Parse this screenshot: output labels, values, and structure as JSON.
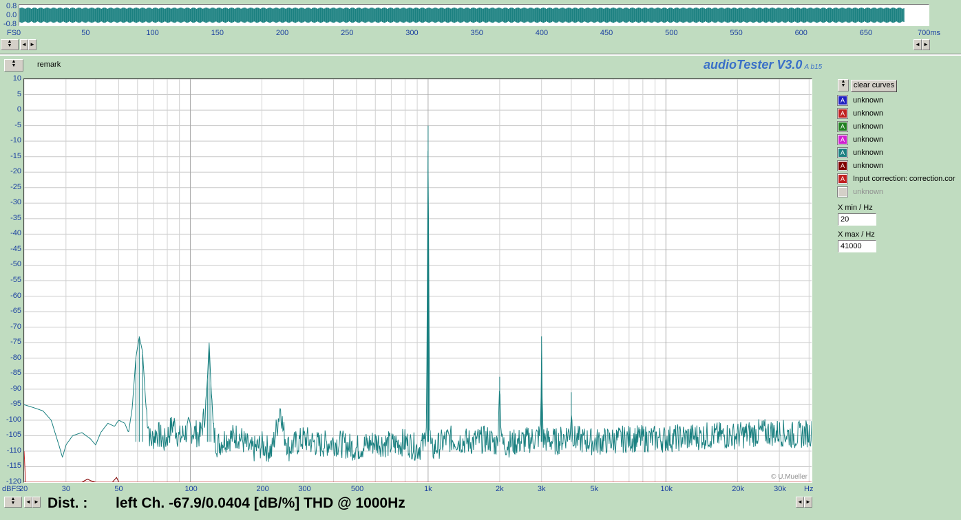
{
  "waveform": {
    "y_ticks": [
      "0.8",
      "0.0",
      "-0.8"
    ],
    "fs_label": "FS",
    "x_ticks": [
      "0",
      "50",
      "100",
      "150",
      "200",
      "250",
      "300",
      "350",
      "400",
      "450",
      "500",
      "550",
      "600",
      "650"
    ],
    "x_end_label": "700ms",
    "signal_end_ms": 682,
    "color": "#1a8080"
  },
  "header": {
    "remark_label": "remark",
    "app_title": "audioTester V3.0",
    "version": "A b15"
  },
  "legend": {
    "clear_button": "clear curves",
    "items": [
      {
        "label": "unknown",
        "color": "#2020c0"
      },
      {
        "label": "unknown",
        "color": "#c02020"
      },
      {
        "label": "unknown",
        "color": "#208020"
      },
      {
        "label": "unknown",
        "color": "#d020d0"
      },
      {
        "label": "unknown",
        "color": "#1a8080"
      },
      {
        "label": "unknown",
        "color": "#800000"
      },
      {
        "label": "Input correction: correction.cor",
        "color": "#c02020"
      },
      {
        "label": "unknown",
        "color": "#d4d0c8",
        "disabled": true
      }
    ],
    "xmin_label": "X min / Hz",
    "xmin_value": "20",
    "xmax_label": "X max / Hz",
    "xmax_value": "41000"
  },
  "status": {
    "dist_label": "Dist. :",
    "result_text": "left Ch. -67.9/0.0404 [dB/%] THD @ 1000Hz"
  },
  "chart_data": {
    "type": "line",
    "xscale": "log",
    "xlim": [
      20,
      41000
    ],
    "ylim": [
      -120,
      10
    ],
    "ylabel": "dBFS",
    "xunit": "Hz",
    "y_ticks": [
      10,
      5,
      0,
      -5,
      -10,
      -15,
      -20,
      -25,
      -30,
      -35,
      -40,
      -45,
      -50,
      -55,
      -60,
      -65,
      -70,
      -75,
      -80,
      -85,
      -90,
      -95,
      -100,
      -105,
      -110,
      -115,
      -120
    ],
    "x_tick_labels": [
      {
        "v": 30,
        "t": "30"
      },
      {
        "v": 50,
        "t": "50"
      },
      {
        "v": 100,
        "t": "100"
      },
      {
        "v": 200,
        "t": "200"
      },
      {
        "v": 300,
        "t": "300"
      },
      {
        "v": 500,
        "t": "500"
      },
      {
        "v": 1000,
        "t": "1k"
      },
      {
        "v": 2000,
        "t": "2k"
      },
      {
        "v": 3000,
        "t": "3k"
      },
      {
        "v": 5000,
        "t": "5k"
      },
      {
        "v": 10000,
        "t": "10k"
      },
      {
        "v": 20000,
        "t": "20k"
      },
      {
        "v": 30000,
        "t": "30k"
      }
    ],
    "x_first_label": "20",
    "watermark": "© U.Mueller",
    "grid": true,
    "series": [
      {
        "color": "#1a8080",
        "noise_floor": -106,
        "points": [
          [
            20,
            -95
          ],
          [
            22,
            -96
          ],
          [
            24,
            -97
          ],
          [
            26,
            -100
          ],
          [
            28,
            -108
          ],
          [
            29,
            -112
          ],
          [
            30,
            -108
          ],
          [
            32,
            -105
          ],
          [
            35,
            -104
          ],
          [
            38,
            -106
          ],
          [
            40,
            -108
          ],
          [
            42,
            -104
          ],
          [
            45,
            -101
          ],
          [
            48,
            -102
          ],
          [
            50,
            -100
          ],
          [
            53,
            -101
          ],
          [
            55,
            -104
          ],
          [
            57,
            -96
          ],
          [
            59,
            -80
          ],
          [
            61,
            -73
          ],
          [
            63,
            -78
          ],
          [
            65,
            -95
          ],
          [
            68,
            -107
          ],
          [
            72,
            -104
          ],
          [
            78,
            -107
          ],
          [
            85,
            -101
          ],
          [
            90,
            -106
          ],
          [
            95,
            -104
          ],
          [
            100,
            -103
          ],
          [
            105,
            -104
          ],
          [
            110,
            -105
          ],
          [
            115,
            -98
          ],
          [
            118,
            -87
          ],
          [
            120,
            -75
          ],
          [
            122,
            -88
          ],
          [
            125,
            -104
          ],
          [
            130,
            -108
          ],
          [
            140,
            -106
          ],
          [
            160,
            -105
          ],
          [
            180,
            -110
          ],
          [
            200,
            -108
          ],
          [
            220,
            -110
          ],
          [
            230,
            -103
          ],
          [
            240,
            -95
          ],
          [
            245,
            -103
          ],
          [
            260,
            -109
          ],
          [
            300,
            -106
          ],
          [
            350,
            -108
          ],
          [
            400,
            -107
          ],
          [
            500,
            -109
          ],
          [
            600,
            -107
          ],
          [
            700,
            -108
          ],
          [
            800,
            -107
          ],
          [
            900,
            -109
          ],
          [
            960,
            -108
          ],
          [
            985,
            -100
          ],
          [
            995,
            -40
          ],
          [
            1000,
            -5
          ],
          [
            1005,
            -40
          ],
          [
            1015,
            -103
          ],
          [
            1030,
            -110
          ],
          [
            1200,
            -106
          ],
          [
            1500,
            -107
          ],
          [
            1800,
            -106
          ],
          [
            1950,
            -108
          ],
          [
            1990,
            -95
          ],
          [
            2000,
            -86
          ],
          [
            2010,
            -96
          ],
          [
            2050,
            -108
          ],
          [
            2400,
            -107
          ],
          [
            2800,
            -106
          ],
          [
            2960,
            -105
          ],
          [
            2990,
            -90
          ],
          [
            3000,
            -73
          ],
          [
            3010,
            -90
          ],
          [
            3050,
            -106
          ],
          [
            3500,
            -107
          ],
          [
            3950,
            -104
          ],
          [
            3990,
            -99
          ],
          [
            4000,
            -91
          ],
          [
            4010,
            -100
          ],
          [
            4100,
            -106
          ],
          [
            5000,
            -107
          ],
          [
            7000,
            -106
          ],
          [
            10000,
            -106
          ],
          [
            15000,
            -105
          ],
          [
            20000,
            -105
          ],
          [
            25000,
            -104
          ],
          [
            30000,
            -104
          ],
          [
            35000,
            -105
          ],
          [
            41000,
            -104
          ]
        ]
      },
      {
        "color": "#800000",
        "points": [
          [
            20,
            -120
          ],
          [
            35,
            -120
          ],
          [
            37,
            -119
          ],
          [
            38,
            -119.5
          ],
          [
            40,
            -120
          ],
          [
            47,
            -120
          ],
          [
            49,
            -118.5
          ],
          [
            50,
            -120
          ],
          [
            41000,
            -120
          ]
        ]
      },
      {
        "color": "#c02020",
        "points": [
          [
            20,
            -110
          ],
          [
            20.3,
            -120
          ],
          [
            41000,
            -120
          ]
        ]
      }
    ]
  }
}
